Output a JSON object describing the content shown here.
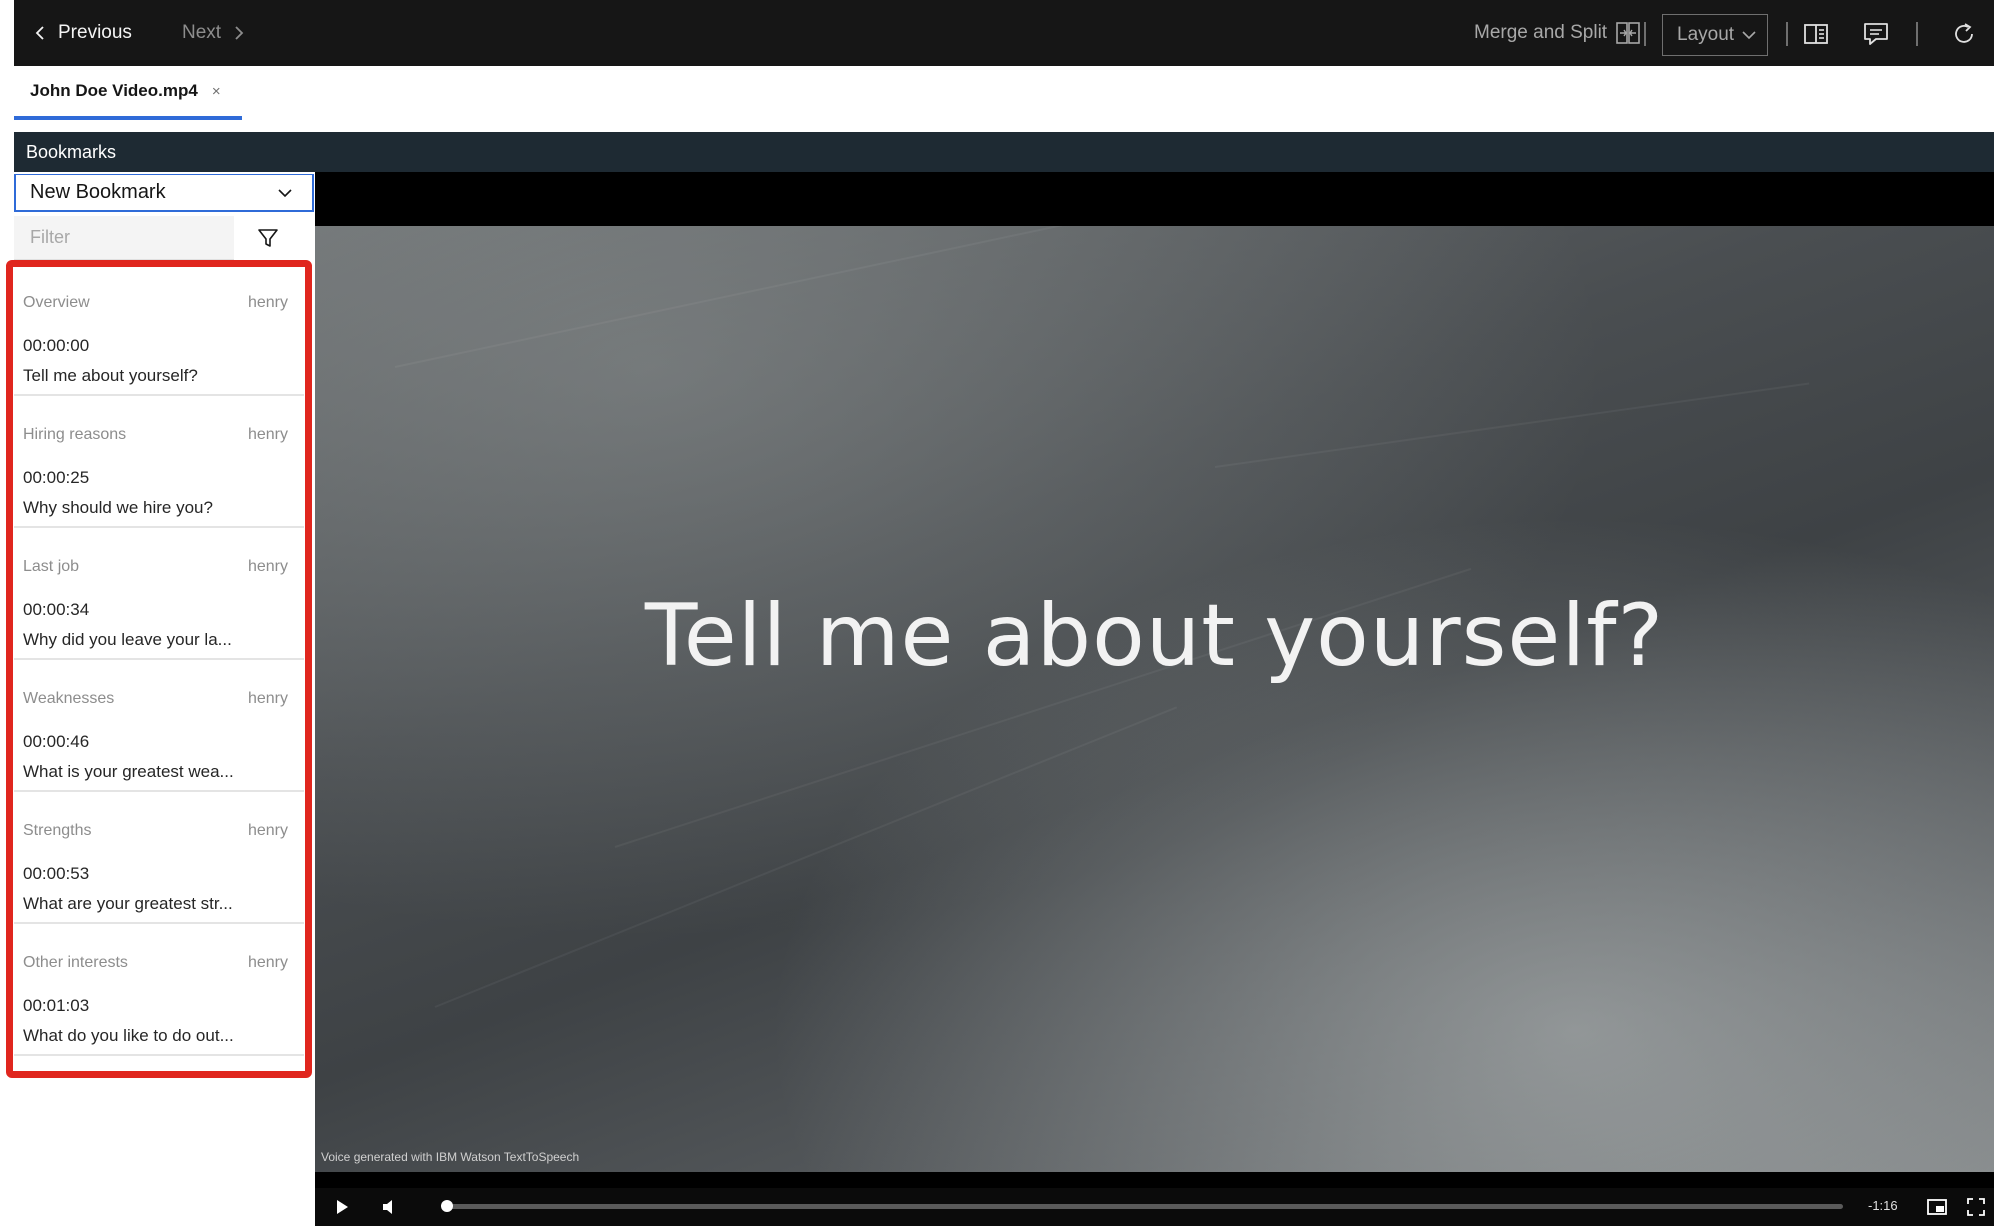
{
  "toolbar": {
    "previous_label": "Previous",
    "next_label": "Next",
    "merge_label": "Merge and Split",
    "layout_label": "Layout"
  },
  "tab": {
    "label": "John Doe Video.mp4",
    "close": "×"
  },
  "bookmarks": {
    "header": "Bookmarks",
    "select_value": "New Bookmark",
    "filter_placeholder": "Filter",
    "items": [
      {
        "category": "Overview",
        "user": "henry",
        "time": "00:00:00",
        "question": "Tell me about yourself?"
      },
      {
        "category": "Hiring reasons",
        "user": "henry",
        "time": "00:00:25",
        "question": "Why should we hire you?"
      },
      {
        "category": "Last job",
        "user": "henry",
        "time": "00:00:34",
        "question": "Why did you leave your la..."
      },
      {
        "category": "Weaknesses",
        "user": "henry",
        "time": "00:00:46",
        "question": "What is your greatest wea..."
      },
      {
        "category": "Strengths",
        "user": "henry",
        "time": "00:00:53",
        "question": "What are your greatest str..."
      },
      {
        "category": "Other interests",
        "user": "henry",
        "time": "00:01:03",
        "question": "What do you like to do out..."
      }
    ]
  },
  "video": {
    "frame_text": "Tell me about yourself?",
    "credit": "Voice  generated with  IBM Watson TextToSpeech",
    "remaining": "-1:16",
    "progress": 0.0
  },
  "colors": {
    "accent": "#2f6bd8",
    "highlight": "#e0261e",
    "toolbar_bg": "#161616",
    "header_bg": "#1e2a33"
  }
}
